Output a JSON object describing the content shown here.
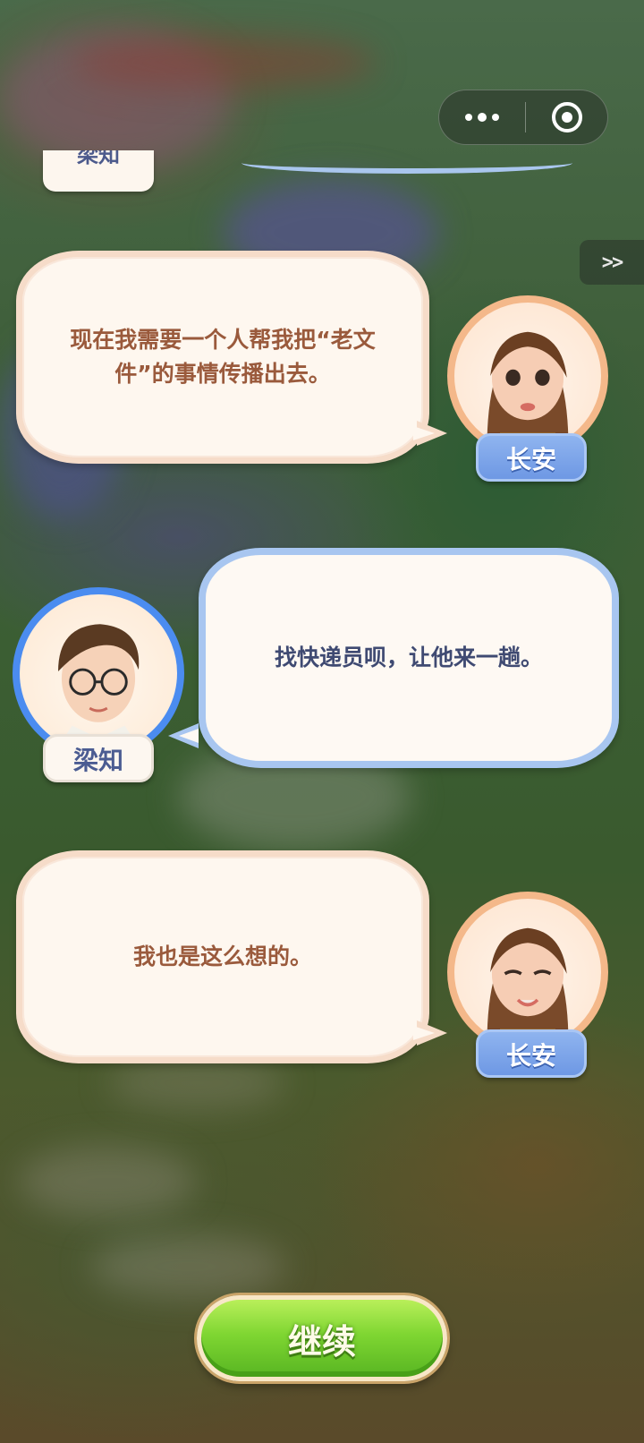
{
  "top_bar": {
    "menu_icon": "more-dots-icon",
    "close_icon": "target-ring-icon"
  },
  "skip_button": {
    "label": ">>"
  },
  "previous_speaker": {
    "name": "梁知"
  },
  "dialogue": [
    {
      "speaker": "长安",
      "side": "right",
      "text_lines": [
        "现在我需要一个人帮我把“老文",
        "件”的事情传播出去。"
      ]
    },
    {
      "speaker": "梁知",
      "side": "left",
      "text_lines": [
        "找快递员呗，让他来一趟。"
      ]
    },
    {
      "speaker": "长安",
      "side": "right",
      "text_lines": [
        "我也是这么想的。"
      ]
    }
  ],
  "continue_button": {
    "label": "继续"
  },
  "colors": {
    "warm_bubble_text": "#9a5a3c",
    "cool_bubble_text": "#3f4a72",
    "female_avatar_ring": "#f4b88a",
    "male_avatar_ring": "#4b8cf0",
    "continue_green": "#7fd632"
  }
}
